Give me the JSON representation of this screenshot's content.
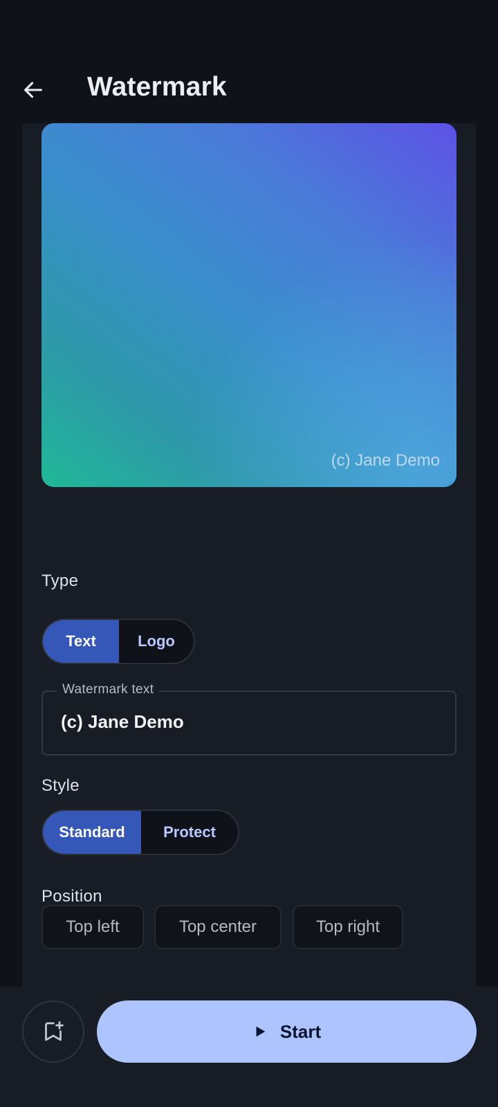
{
  "header": {
    "title": "Watermark",
    "back_icon": "arrow-left-icon"
  },
  "preview": {
    "watermark_text": "(c) Jane Demo"
  },
  "type": {
    "label": "Type",
    "options": [
      "Text",
      "Logo"
    ],
    "selected": "Text"
  },
  "watermark_field": {
    "label": "Watermark text",
    "value": "(c) Jane Demo"
  },
  "style": {
    "label": "Style",
    "options": [
      "Standard",
      "Protect"
    ],
    "selected": "Standard"
  },
  "position": {
    "label": "Position",
    "options": [
      "Top left",
      "Top center",
      "Top right"
    ]
  },
  "bottom": {
    "bookmark_icon": "bookmark-add-icon",
    "start_icon": "play-icon",
    "start_label": "Start"
  },
  "colors": {
    "accent": "#adc4ff",
    "selected_segment": "#3558b8",
    "background": "#0f1218",
    "panel": "#181c24"
  }
}
